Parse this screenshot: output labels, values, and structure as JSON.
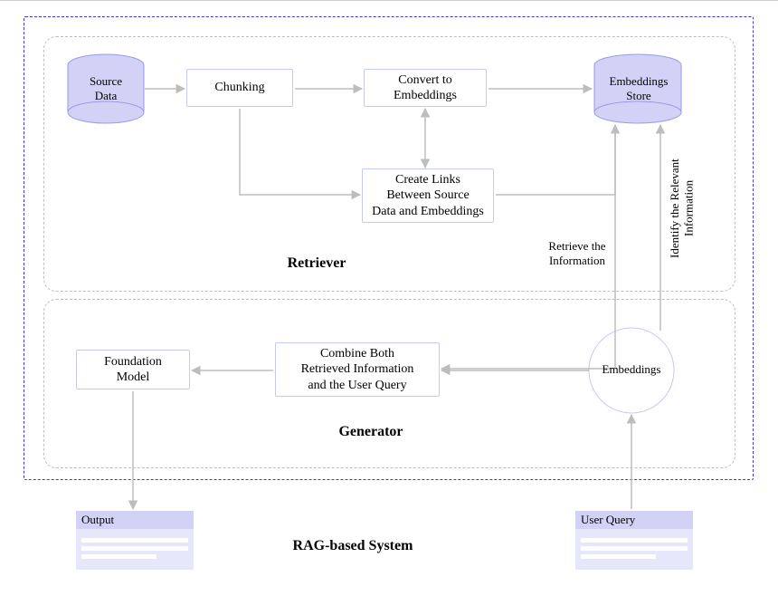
{
  "system": {
    "title": "RAG-based System",
    "retriever": {
      "title": "Retriever",
      "nodes": {
        "source_data": "Source\nData",
        "chunking": "Chunking",
        "convert": "Convert to\nEmbeddings",
        "create_links": "Create Links\nBetween Source\nData and Embeddings",
        "embeddings_store": "Embeddings\nStore"
      }
    },
    "generator": {
      "title": "Generator",
      "nodes": {
        "foundation_model": "Foundation\nModel",
        "combine": "Combine Both\nRetrieved Information\nand the User Query",
        "embeddings": "Embeddings"
      }
    },
    "edge_labels": {
      "retrieve": "Retrieve the\nInformation",
      "identify": "Identify the Relevant\nInformation"
    },
    "external": {
      "output": "Output",
      "user_query": "User Query"
    }
  }
}
